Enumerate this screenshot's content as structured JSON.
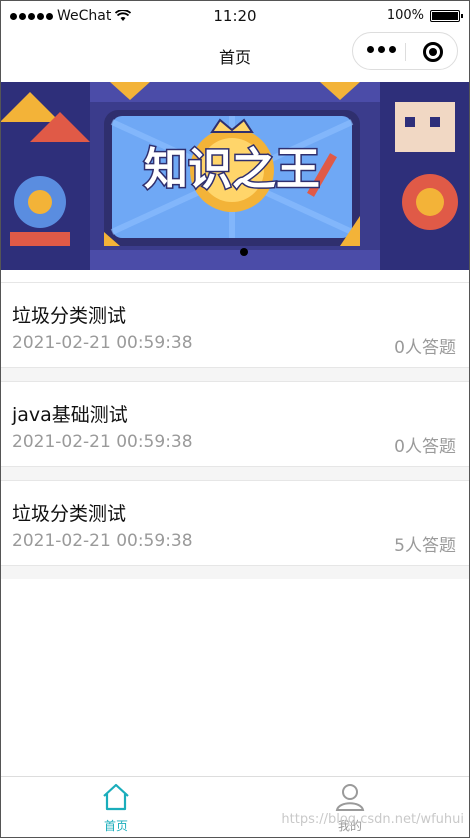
{
  "status_bar": {
    "carrier": "WeChat",
    "time": "11:20",
    "battery": "100%"
  },
  "nav": {
    "title": "首页"
  },
  "banner": {
    "alt_text": "知识之王"
  },
  "quizzes": [
    {
      "name": "垃圾分类测试",
      "date": "2021-02-21 00:59:38",
      "count": "0人答题"
    },
    {
      "name": "java基础测试",
      "date": "2021-02-21 00:59:38",
      "count": "0人答题"
    },
    {
      "name": "垃圾分类测试",
      "date": "2021-02-21 00:59:38",
      "count": "5人答题"
    }
  ],
  "tabs": {
    "home": "首页",
    "mine": "我的"
  },
  "colors": {
    "accent": "#1aadbb",
    "muted": "#9a9a9a"
  },
  "watermark": "https://blog.csdn.net/wfuhui"
}
